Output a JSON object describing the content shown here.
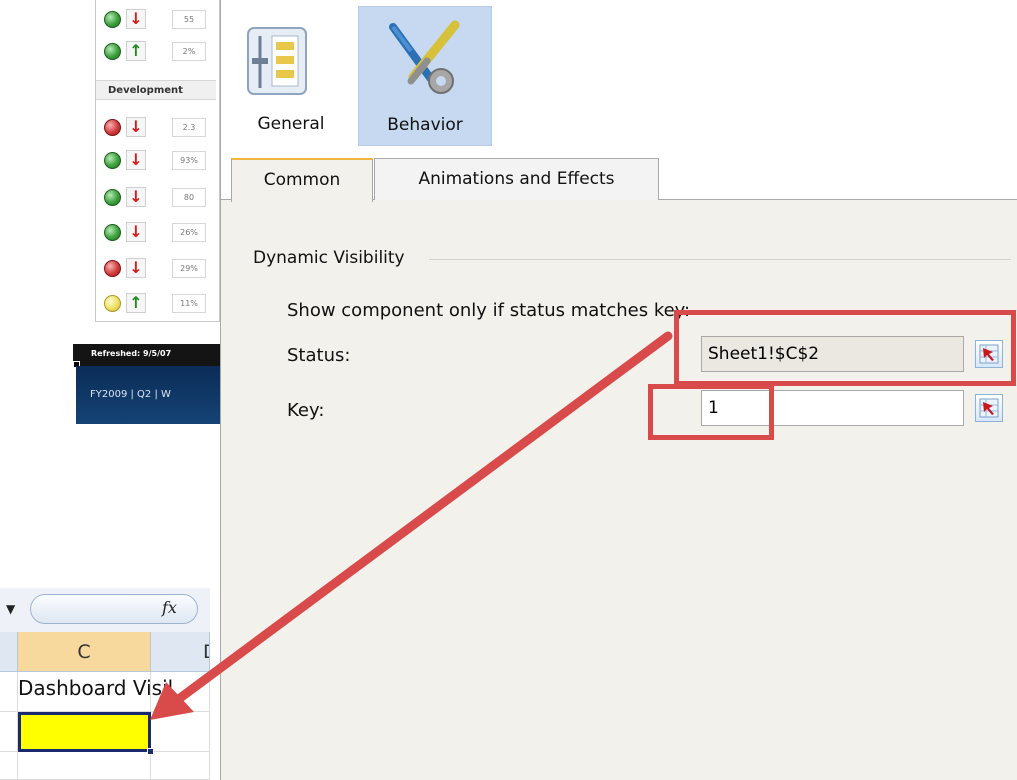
{
  "dashboard": {
    "rows_top": [
      {
        "status": "green",
        "trend": "down",
        "value": "55"
      },
      {
        "status": "green",
        "trend": "up",
        "value": "2%"
      }
    ],
    "section_title": "Development",
    "rows_dev": [
      {
        "status": "red",
        "trend": "down",
        "value": "2.3"
      },
      {
        "status": "green",
        "trend": "down",
        "value": "93%"
      },
      {
        "status": "green",
        "trend": "down",
        "value": "80"
      },
      {
        "status": "green",
        "trend": "down",
        "value": "26%"
      },
      {
        "status": "red",
        "trend": "down",
        "value": "29%"
      },
      {
        "status": "yellow",
        "trend": "up",
        "value": "11%"
      }
    ],
    "refreshed_text": "Refreshed: 9/5/07",
    "footer_text": "FY2009 | Q2 | W"
  },
  "excel": {
    "fx_label": "fx",
    "columns": [
      "C",
      "D"
    ],
    "cell_text": "Dashboard Visil",
    "selected_cell_color": "#ffff00"
  },
  "properties": {
    "categories": [
      {
        "label": "General",
        "icon": "general-settings-icon",
        "selected": false
      },
      {
        "label": "Behavior",
        "icon": "behavior-tools-icon",
        "selected": true
      }
    ],
    "sub_tabs": [
      {
        "label": "Common",
        "active": true
      },
      {
        "label": "Animations and Effects",
        "active": false
      }
    ],
    "group_title": "Dynamic Visibility",
    "description": "Show component only if status matches key:",
    "status_label": "Status:",
    "status_value": "Sheet1!$C$2",
    "key_label": "Key:",
    "key_value": "1"
  },
  "colors": {
    "annotation": "#d94a4a",
    "selected_tab": "#c6d9f0",
    "panel_bg": "#f2f1ec"
  }
}
